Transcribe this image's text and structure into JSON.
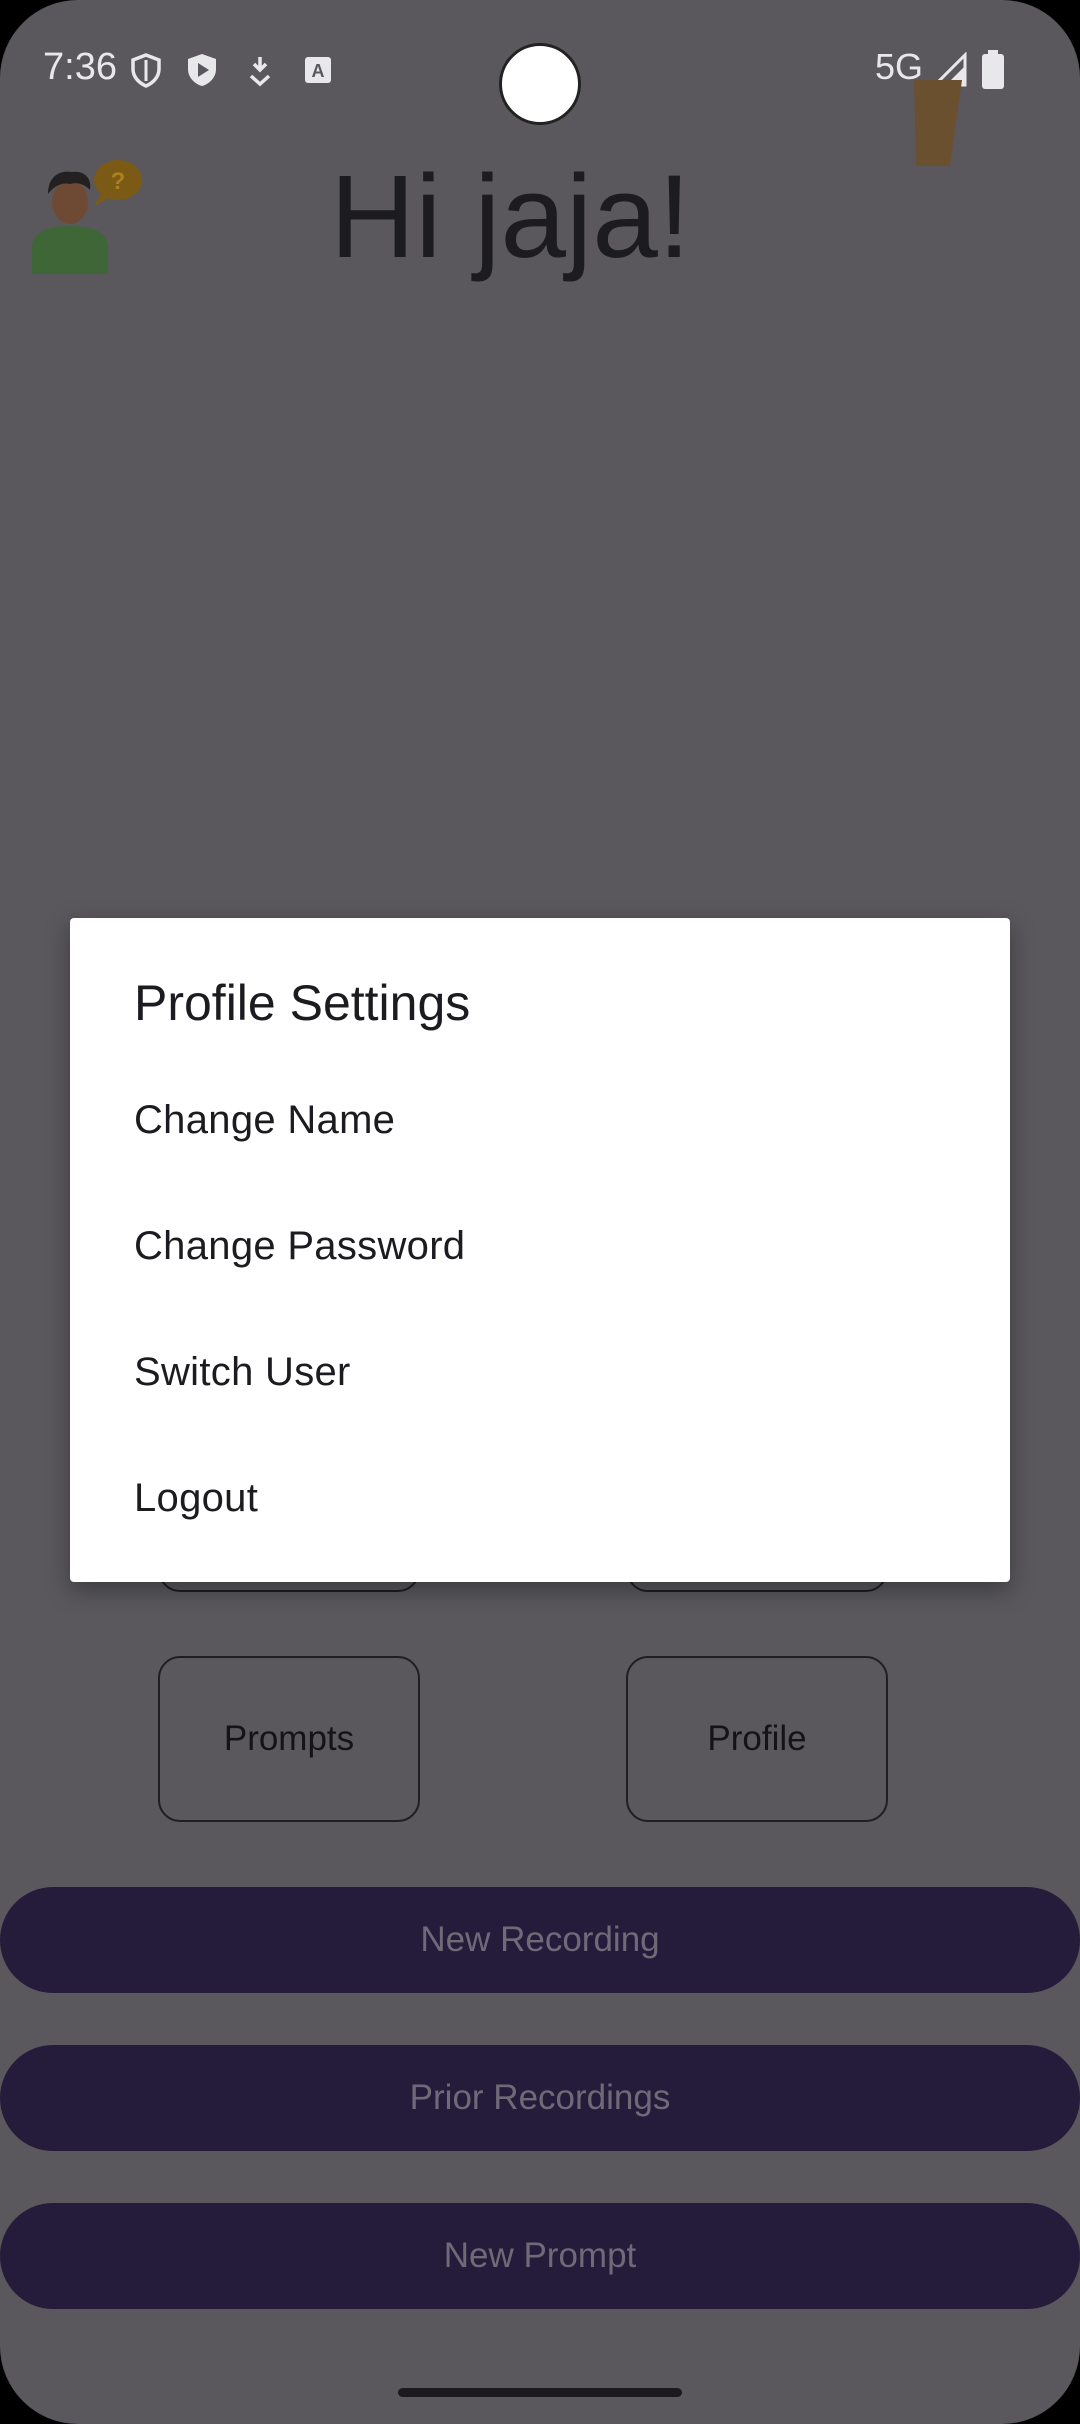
{
  "status_bar": {
    "time": "7:36",
    "network": "5G",
    "icons": [
      "shield-icon",
      "play-protect-icon",
      "download-icon",
      "accessibility-font-icon",
      "signal-icon",
      "battery-icon"
    ]
  },
  "header": {
    "greeting": "Hi jaja!",
    "avatar_icon": "person-question-icon"
  },
  "grid_buttons": {
    "prompts": "Prompts",
    "profile": "Profile"
  },
  "actions": {
    "new_recording": "New Recording",
    "prior_recordings": "Prior Recordings",
    "new_prompt": "New Prompt"
  },
  "dialog": {
    "title": "Profile Settings",
    "items": [
      "Change Name",
      "Change Password",
      "Switch User",
      "Logout"
    ]
  },
  "colors": {
    "scrim": "#5a585c",
    "pill": "#251c3b",
    "dialog": "#ffffff"
  }
}
